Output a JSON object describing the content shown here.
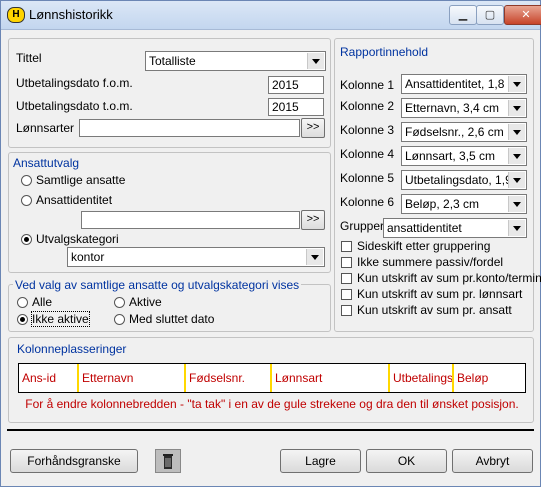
{
  "window": {
    "title": "Lønnshistorikk",
    "app_icon_letter": "H"
  },
  "top": {
    "tittel_label": "Tittel",
    "tittel_value": "Totalliste",
    "fom_label": "Utbetalingsdato f.o.m.",
    "fom_value": "2015",
    "tom_label": "Utbetalingsdato t.o.m.",
    "tom_value": "2015",
    "lonnsarter_label": "Lønnsarter",
    "lonnsarter_value": "",
    "browse": ">>"
  },
  "ansattutvalg": {
    "legend": "Ansattutvalg",
    "samtlige": "Samtlige ansatte",
    "ansattidentitet": "Ansattidentitet",
    "ansattidentitet_value": "",
    "browse": ">>",
    "utvalgskategori": "Utvalgskategori",
    "kategori_value": "kontor",
    "selected": "utvalgskategori"
  },
  "vedvalg": {
    "legend": "Ved valg av samtlige ansatte og utvalgskategori vises",
    "alle": "Alle",
    "aktive": "Aktive",
    "ikke_aktive": "Ikke aktive",
    "med_sluttet": "Med sluttet dato",
    "selected": "ikke_aktive"
  },
  "rapport": {
    "legend": "Rapportinnehold",
    "kolonner": [
      {
        "label": "Kolonne 1",
        "value": "Ansattidentitet, 1,8 cm"
      },
      {
        "label": "Kolonne 2",
        "value": "Etternavn, 3,4 cm"
      },
      {
        "label": "Kolonne 3",
        "value": "Fødselsnr., 2,6 cm"
      },
      {
        "label": "Kolonne 4",
        "value": "Lønnsart, 3,5 cm"
      },
      {
        "label": "Kolonne 5",
        "value": "Utbetalingsdato, 1,9 c"
      },
      {
        "label": "Kolonne 6",
        "value": "Beløp, 2,3 cm"
      }
    ],
    "gruppere_label": "Gruppere etter",
    "gruppere_value": "ansattidentitet",
    "checks": [
      "Sideskift etter gruppering",
      "Ikke summere passiv/fordel",
      "Kun utskrift av sum pr.konto/termin",
      "Kun utskrift av sum pr. lønnsart",
      "Kun utskrift av sum pr. ansatt"
    ]
  },
  "kolonneplasseringer": {
    "legend": "Kolonneplasseringer",
    "columns": [
      "Ans-id",
      "Etternavn",
      "Fødselsnr.",
      "Lønnsart",
      "Utbetalingsdato",
      "Beløp"
    ],
    "hint": "For å endre kolonnebredden - \"ta tak\" i en av de gule strekene og dra den til ønsket posisjon."
  },
  "buttons": {
    "forhandsgranske": "Forhåndsgranske",
    "lagre": "Lagre",
    "ok": "OK",
    "avbryt": "Avbryt"
  },
  "colors": {
    "accent_text": "#0033a0",
    "warning_text": "#c00000",
    "column_separator": "#ffd800"
  }
}
